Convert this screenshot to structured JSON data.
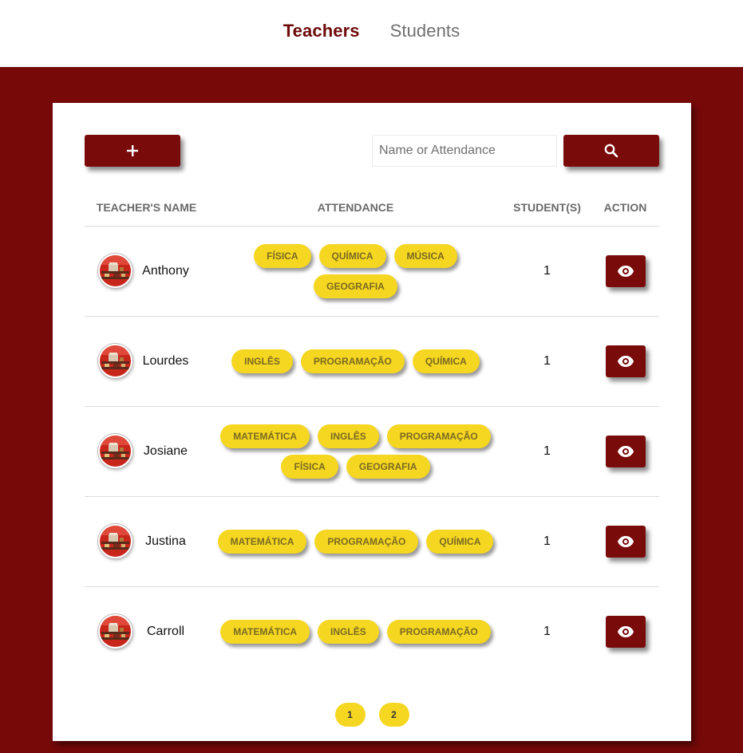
{
  "nav": {
    "teachers": "Teachers",
    "students": "Students"
  },
  "toolbar": {
    "add_label": "+",
    "search_placeholder": "Name or Attendance"
  },
  "table": {
    "headers": [
      "TEACHER'S NAME",
      "ATTENDANCE",
      "STUDENT(S)",
      "ACTION"
    ],
    "rows": [
      {
        "name": "Anthony",
        "subjects": [
          "FÍSICA",
          "QUÍMICA",
          "MÚSICA",
          "GEOGRAFIA"
        ],
        "students": "1"
      },
      {
        "name": "Lourdes",
        "subjects": [
          "INGLÊS",
          "PROGRAMAÇÃO",
          "QUÍMICA"
        ],
        "students": "1"
      },
      {
        "name": "Josiane",
        "subjects": [
          "MATEMÁTICA",
          "INGLÊS",
          "PROGRAMAÇÃO",
          "FÍSICA",
          "GEOGRAFIA"
        ],
        "students": "1"
      },
      {
        "name": "Justina",
        "subjects": [
          "MATEMÁTICA",
          "PROGRAMAÇÃO",
          "QUÍMICA"
        ],
        "students": "1"
      },
      {
        "name": "Carroll",
        "subjects": [
          "MATEMÁTICA",
          "INGLÊS",
          "PROGRAMAÇÃO"
        ],
        "students": "1"
      }
    ]
  },
  "pagination": {
    "pages": [
      "1",
      "2"
    ]
  },
  "icons": {
    "add": "plus-icon",
    "search": "search-icon",
    "view": "eye-icon"
  },
  "colors": {
    "brand": "#770909",
    "button": "#7a0b0b",
    "tag": "#f5d620",
    "active_nav": "#6e0a0a"
  }
}
